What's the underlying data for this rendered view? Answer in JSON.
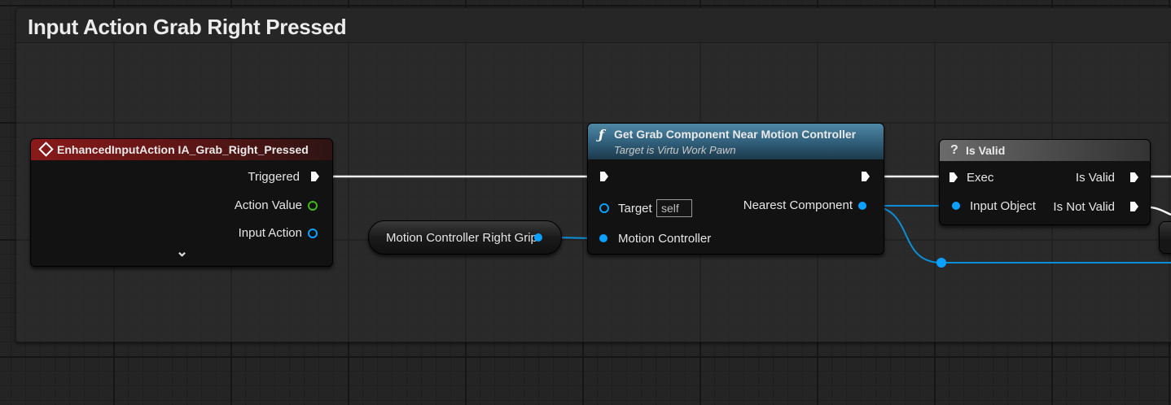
{
  "comment": {
    "title": "Input Action Grab Right Pressed"
  },
  "event_node": {
    "title": "EnhancedInputAction IA_Grab_Right_Pressed",
    "pins": [
      "Triggered",
      "Action Value",
      "Input Action"
    ],
    "expand_glyph": "⌄"
  },
  "variable_node": {
    "label": "Motion Controller Right Grip"
  },
  "function_node": {
    "icon": "ƒ",
    "title": "Get Grab Component Near Motion Controller",
    "subtitle": "Target is Virtu Work Pawn",
    "target_label": "Target",
    "target_value": "self",
    "motion_controller_label": "Motion Controller",
    "output_label": "Nearest Component"
  },
  "isvalid_node": {
    "icon": "?",
    "title": "Is Valid",
    "exec_label": "Exec",
    "input_label": "Input Object",
    "out_valid": "Is Valid",
    "out_not_valid": "Is Not Valid"
  },
  "colors": {
    "event_header": "#8a1a1a",
    "function_header": "#3d6e87",
    "isvalid_header": "#6b6b6b",
    "object_pin": "#0aa1ff",
    "struct_pin": "#3dbb12",
    "exec_wire": "#ffffff"
  }
}
